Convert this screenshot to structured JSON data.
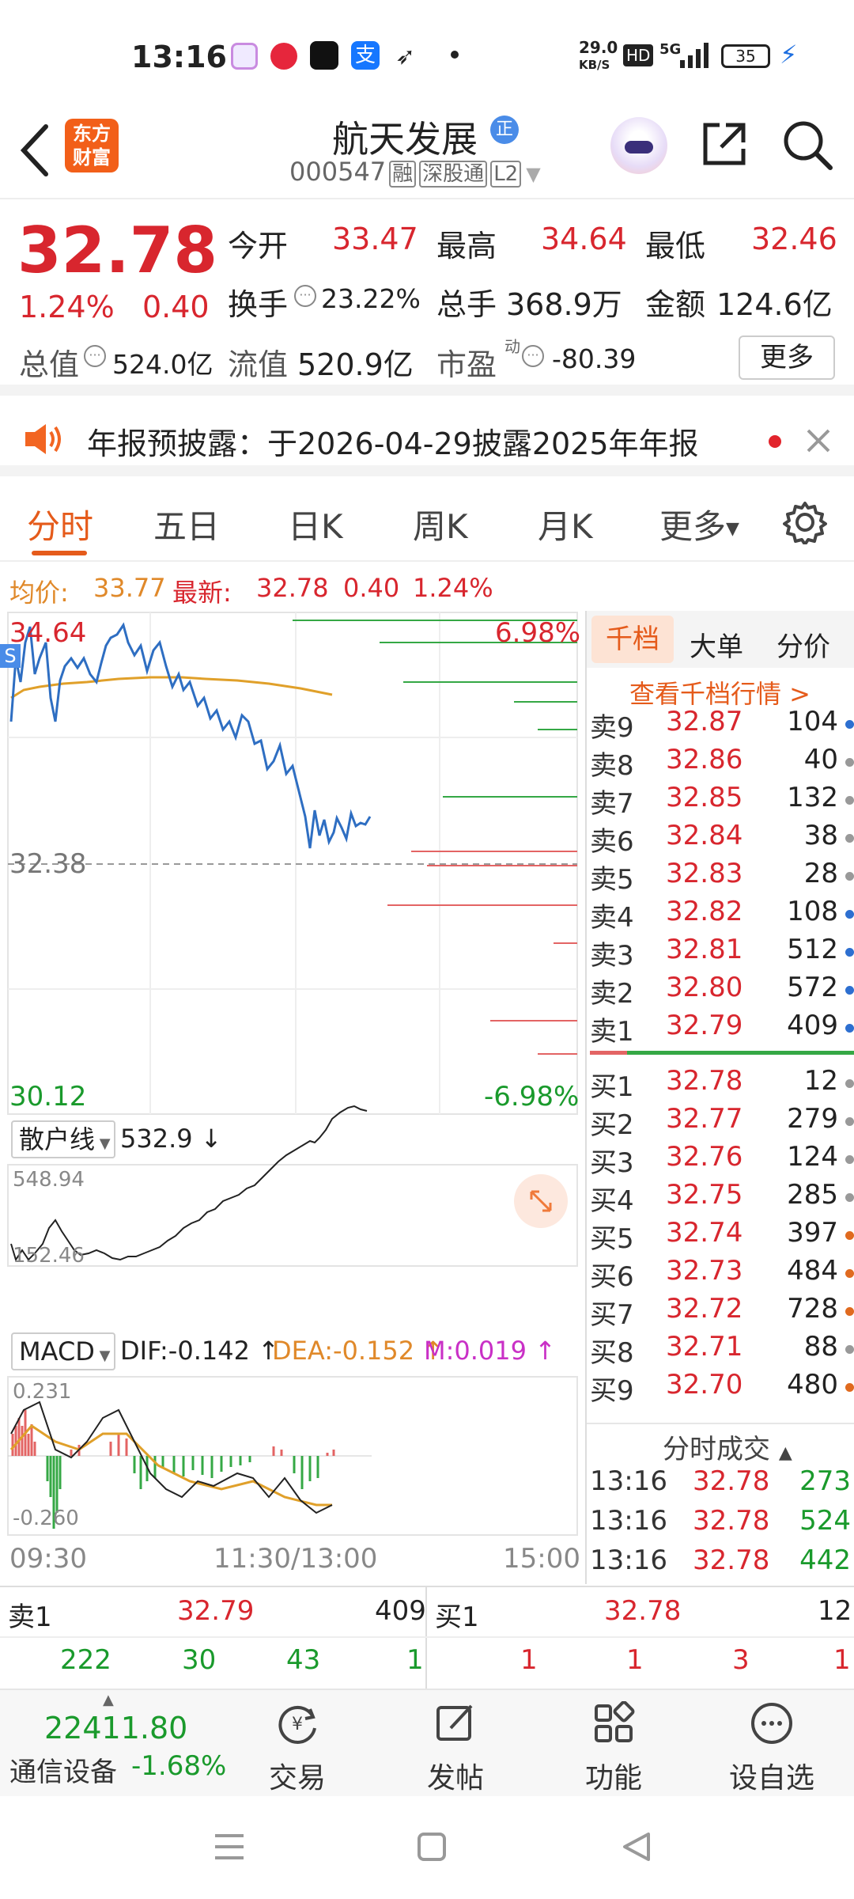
{
  "status": {
    "time": "13:16",
    "net_speed_top": "29.0",
    "net_speed_bottom": "KB/S",
    "hd": "HD",
    "signal": "5G",
    "battery": "35"
  },
  "header": {
    "logo_line1": "东方",
    "logo_line2": "财富",
    "stock_name": "航天发展",
    "name_badge": "正",
    "stock_code": "000547",
    "tags": [
      "融",
      "深股通",
      "L2"
    ]
  },
  "quote": {
    "price": "32.78",
    "change_pct": "1.24%",
    "change_amt": "0.40",
    "open_label": "今开",
    "open": "33.47",
    "high_label": "最高",
    "high": "34.64",
    "low_label": "最低",
    "low": "32.46",
    "turnover_label": "换手",
    "turnover": "23.22%",
    "vol_label": "总手",
    "vol": "368.9万",
    "amount_label": "金额",
    "amount": "124.6亿",
    "mcap_label": "总值",
    "mcap": "524.0亿",
    "float_label": "流值",
    "float_cap": "520.9亿",
    "pe_label": "市盈",
    "pe_sup": "动",
    "pe": "-80.39",
    "more": "更多"
  },
  "notice": {
    "text": "年报预披露：于2026-04-29披露2025年年报"
  },
  "tabs": [
    "分时",
    "五日",
    "日K",
    "周K",
    "月K",
    "更多"
  ],
  "infoline": {
    "avg_label": "均价:",
    "avg": "33.77",
    "latest_label": "最新:",
    "latest": "32.78",
    "chg": "0.40",
    "pct": "1.24%"
  },
  "chart": {
    "price_max": "34.64",
    "price_min": "30.12",
    "pct_max": "6.98%",
    "pct_min": "-6.98%",
    "prev_close": "32.38",
    "s_badge": "S",
    "retail_label": "散户线",
    "retail_value": "532.9",
    "retail_max": "548.94",
    "retail_min": "152.46",
    "macd_label": "MACD",
    "dif": "DIF:-0.142",
    "dea": "DEA:-0.152",
    "m": "M:0.019",
    "macd_max": "0.231",
    "macd_min": "-0.260",
    "time_start": "09:30",
    "time_mid": "11:30/13:00",
    "time_end": "15:00"
  },
  "orderbook": {
    "tab_active": "千档",
    "tab2": "大单",
    "tab3": "分价",
    "link": "查看千档行情 >",
    "asks": [
      {
        "label": "卖9",
        "price": "32.87",
        "vol": "104",
        "dot": "#2d6fd0"
      },
      {
        "label": "卖8",
        "price": "32.86",
        "vol": "40",
        "dot": "#999999"
      },
      {
        "label": "卖7",
        "price": "32.85",
        "vol": "132",
        "dot": "#999999"
      },
      {
        "label": "卖6",
        "price": "32.84",
        "vol": "38",
        "dot": "#999999"
      },
      {
        "label": "卖5",
        "price": "32.83",
        "vol": "28",
        "dot": "#999999"
      },
      {
        "label": "卖4",
        "price": "32.82",
        "vol": "108",
        "dot": "#2d6fd0"
      },
      {
        "label": "卖3",
        "price": "32.81",
        "vol": "512",
        "dot": "#2d6fd0"
      },
      {
        "label": "卖2",
        "price": "32.80",
        "vol": "572",
        "dot": "#2d6fd0"
      },
      {
        "label": "卖1",
        "price": "32.79",
        "vol": "409",
        "dot": "#2d6fd0"
      }
    ],
    "bids": [
      {
        "label": "买1",
        "price": "32.78",
        "vol": "12",
        "dot": "#999999"
      },
      {
        "label": "买2",
        "price": "32.77",
        "vol": "279",
        "dot": "#999999"
      },
      {
        "label": "买3",
        "price": "32.76",
        "vol": "124",
        "dot": "#999999"
      },
      {
        "label": "买4",
        "price": "32.75",
        "vol": "285",
        "dot": "#999999"
      },
      {
        "label": "买5",
        "price": "32.74",
        "vol": "397",
        "dot": "#e06a1f"
      },
      {
        "label": "买6",
        "price": "32.73",
        "vol": "484",
        "dot": "#e06a1f"
      },
      {
        "label": "买7",
        "price": "32.72",
        "vol": "728",
        "dot": "#e06a1f"
      },
      {
        "label": "买8",
        "price": "32.71",
        "vol": "88",
        "dot": "#999999"
      },
      {
        "label": "买9",
        "price": "32.70",
        "vol": "480",
        "dot": "#e06a1f"
      }
    ],
    "trades_title": "分时成交",
    "trades": [
      {
        "time": "13:16",
        "price": "32.78",
        "vol": "273"
      },
      {
        "time": "13:16",
        "price": "32.78",
        "vol": "524"
      },
      {
        "time": "13:16",
        "price": "32.78",
        "vol": "442"
      }
    ]
  },
  "bottomquote": {
    "sell_label": "卖1",
    "sell_price": "32.79",
    "sell_vol": "409",
    "buy_label": "买1",
    "buy_price": "32.78",
    "buy_vol": "12",
    "sell_q": [
      "222",
      "30",
      "43",
      "1"
    ],
    "buy_q": [
      "1",
      "1",
      "3",
      "1"
    ]
  },
  "bottomnav": {
    "index_value": "22411.80",
    "index_name": "通信设备",
    "index_pct": "-1.68%",
    "items": [
      "交易",
      "发帖",
      "功能",
      "设自选"
    ]
  }
}
